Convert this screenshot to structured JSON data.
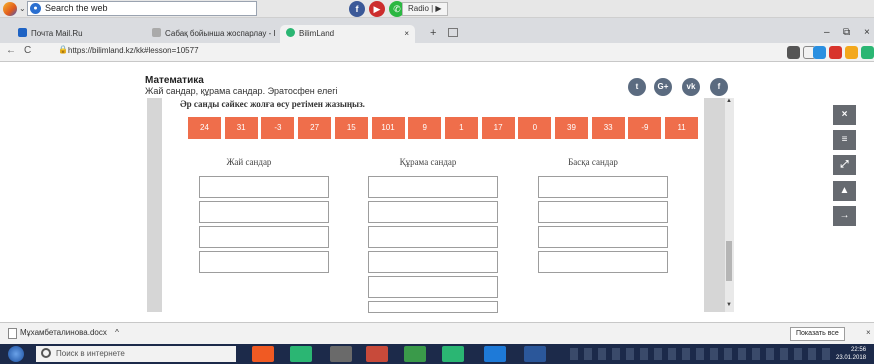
{
  "toolbar": {
    "search_label": "Search the web",
    "social_icons": [
      "facebook-icon",
      "youtube-icon",
      "whatsapp-icon"
    ],
    "radio_label": "Radio | ▶"
  },
  "tabs": [
    {
      "label": "Почта Mail.Ru",
      "color": "#1e63c4"
    },
    {
      "label": "Сабақ бойынша жоспарлау - I",
      "color": "#aaaaaa"
    },
    {
      "label": "BilimLand",
      "color": "#2bb673"
    }
  ],
  "tab_close": "×",
  "new_tab": "+",
  "address": {
    "back": "←",
    "reload": "C",
    "lock": "🔒",
    "url": "https://bilimland.kz/kk#lesson=10577"
  },
  "page": {
    "title": "Математика",
    "subtitle": "Жай сандар, құрама сандар. Эратосфен елегі",
    "social": [
      "twitter-icon",
      "google-plus-icon",
      "vk-icon",
      "facebook-icon"
    ],
    "social_glyphs": [
      "t",
      "G+",
      "vk",
      "f"
    ]
  },
  "exercise": {
    "question": "Әр санды сәйкес жолға өсу ретімен жазыңыз.",
    "numbers": [
      "24",
      "31",
      "-3",
      "27",
      "15",
      "101",
      "9",
      "1",
      "17",
      "0",
      "39",
      "33",
      "-9",
      "11"
    ],
    "tile_color": "#ef6e4b",
    "columns": [
      {
        "header": "Жай сандар"
      },
      {
        "header": "Құрама сандар"
      },
      {
        "header": "Басқа сандар"
      }
    ]
  },
  "side_controls": [
    "×",
    "≡",
    "⤢",
    "▲",
    "→"
  ],
  "download_bar": {
    "file": "Мұхамбеталинова.docx",
    "chevron": "^",
    "show_all": "Показать все",
    "close": "×"
  },
  "taskbar": {
    "search_placeholder": "Поиск в интернете",
    "time": "22:56",
    "date": "23.01.2018"
  }
}
